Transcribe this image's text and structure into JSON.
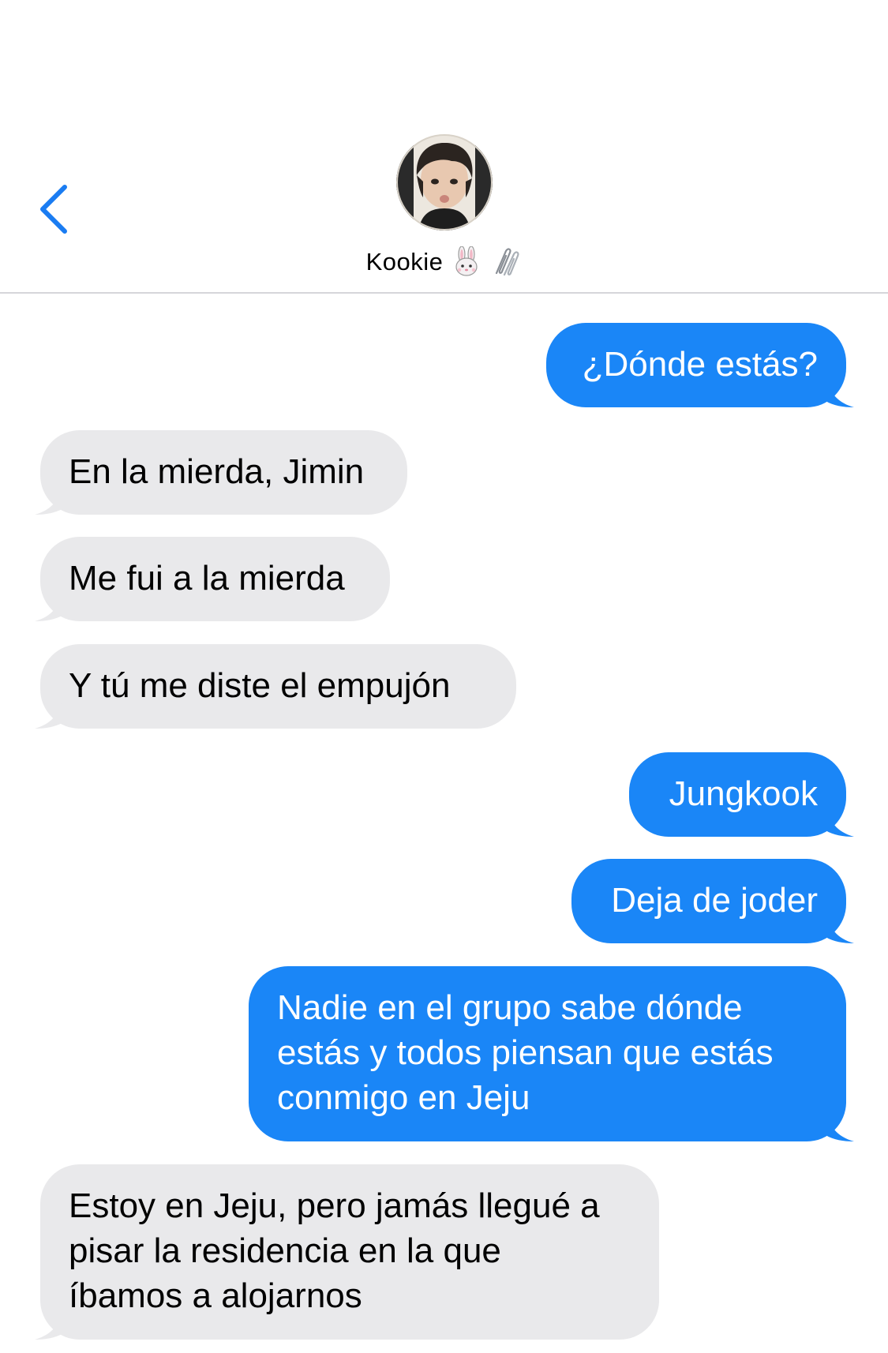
{
  "header": {
    "contact_name": "Kookie",
    "emojis": [
      "rabbit-face-icon",
      "paperclips-icon"
    ]
  },
  "colors": {
    "sent_bubble": "#1a86f7",
    "received_bubble": "#e9e9eb",
    "accent": "#1a7cf2"
  },
  "messages": [
    {
      "direction": "sent",
      "text": "¿Dónde estás?"
    },
    {
      "direction": "received",
      "text": "En la mierda, Jimin"
    },
    {
      "direction": "received",
      "text": "Me fui a la mierda"
    },
    {
      "direction": "received",
      "text": "Y tú me diste el empujón"
    },
    {
      "direction": "sent",
      "text": "Jungkook"
    },
    {
      "direction": "sent",
      "text": "Deja de joder"
    },
    {
      "direction": "sent",
      "lines": [
        "Nadie en el grupo sabe dónde",
        "estás y todos piensan que estás",
        "conmigo en Jeju"
      ]
    },
    {
      "direction": "received",
      "lines": [
        "Estoy en Jeju, pero jamás llegué a",
        "pisar la residencia en la que",
        "íbamos a alojarnos"
      ]
    }
  ]
}
